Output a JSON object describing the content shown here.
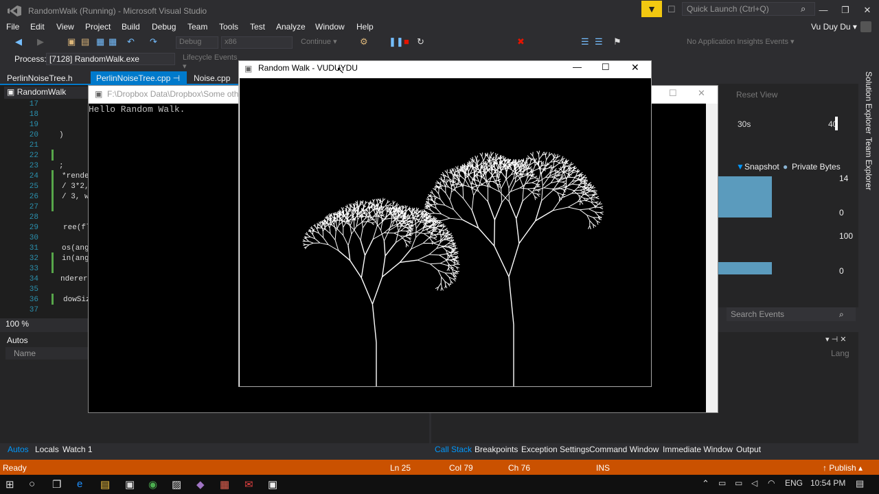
{
  "title_bar": {
    "title": "RandomWalk (Running) - Microsoft Visual Studio",
    "quick_launch_placeholder": "Quick Launch (Ctrl+Q)",
    "minimize": "—",
    "maximize": "❐",
    "close": "✕"
  },
  "menu": [
    "File",
    "Edit",
    "View",
    "Project",
    "Build",
    "Debug",
    "Team",
    "Tools",
    "Test",
    "Analyze",
    "Window",
    "Help"
  ],
  "user": {
    "name": "Vu Duy Du ▾"
  },
  "toolbar": {
    "config": "Debug",
    "platform": "x86",
    "continue_label": "Continue ▾",
    "insights": "No Application Insights Events ▾"
  },
  "process_bar": {
    "label": "Process:",
    "value": "[7128] RandomWalk.exe",
    "lifecycle": "Lifecycle Events ▾"
  },
  "doc_tabs": [
    "PerlinNoiseTree.h",
    "PerlinNoiseTree.cpp",
    "Noise.cpp"
  ],
  "editor": {
    "nav": "RandomWalk",
    "line_numbers": [
      "17",
      "18",
      "19",
      "20",
      "21",
      "22",
      "23",
      "24",
      "25",
      "26",
      "27",
      "28",
      "29",
      "30",
      "31",
      "32",
      "33",
      "34",
      "35",
      "36",
      "37"
    ],
    "fragments": {
      "l20": ")",
      "l23": ";",
      "l24": "*rende",
      "l25": "/ 3*2,",
      "l26": "/ 3, w",
      "l29": "ree(fl",
      "l31": "os(ang",
      "l32": "in(ang",
      "l34": "nderer,",
      "l36": "dowSiz"
    },
    "zoom": "100 %"
  },
  "console": {
    "title": "F:\\Dropbox Data\\Dropbox\\Some other",
    "output": "Hello Random Walk."
  },
  "sdl_window": {
    "title": "Random Walk - VUDUYDU"
  },
  "diagnostics": {
    "reset_view": "Reset View",
    "time_mark": "30s",
    "time_mark_2": "40",
    "legend_snapshot": "Snapshot",
    "legend_private": "Private Bytes",
    "mem_max": "14",
    "mem_min": "0",
    "cpu_max": "100",
    "cpu_min": "0",
    "search_events": "Search Events"
  },
  "autos": {
    "title": "Autos",
    "column_name": "Name",
    "column_lang": "Lang"
  },
  "bottom_tabs_left": [
    "Autos",
    "Locals",
    "Watch 1"
  ],
  "bottom_tabs_right": [
    "Call Stack",
    "Breakpoints",
    "Exception Settings",
    "Command Window",
    "Immediate Window",
    "Output"
  ],
  "side_tabs": [
    "Solution Explorer",
    "Team Explorer"
  ],
  "status_bar": {
    "state": "Ready",
    "line": "Ln 25",
    "col": "Col 79",
    "ch": "Ch 76",
    "mode": "INS",
    "publish": "↑ Publish ▴"
  },
  "taskbar": {
    "language": "ENG",
    "time": "10:54 PM"
  },
  "colors": {
    "accent": "#007acc",
    "status_orange": "#ca5100",
    "bg": "#2d2d30",
    "tree_stroke": "#ffffff"
  }
}
